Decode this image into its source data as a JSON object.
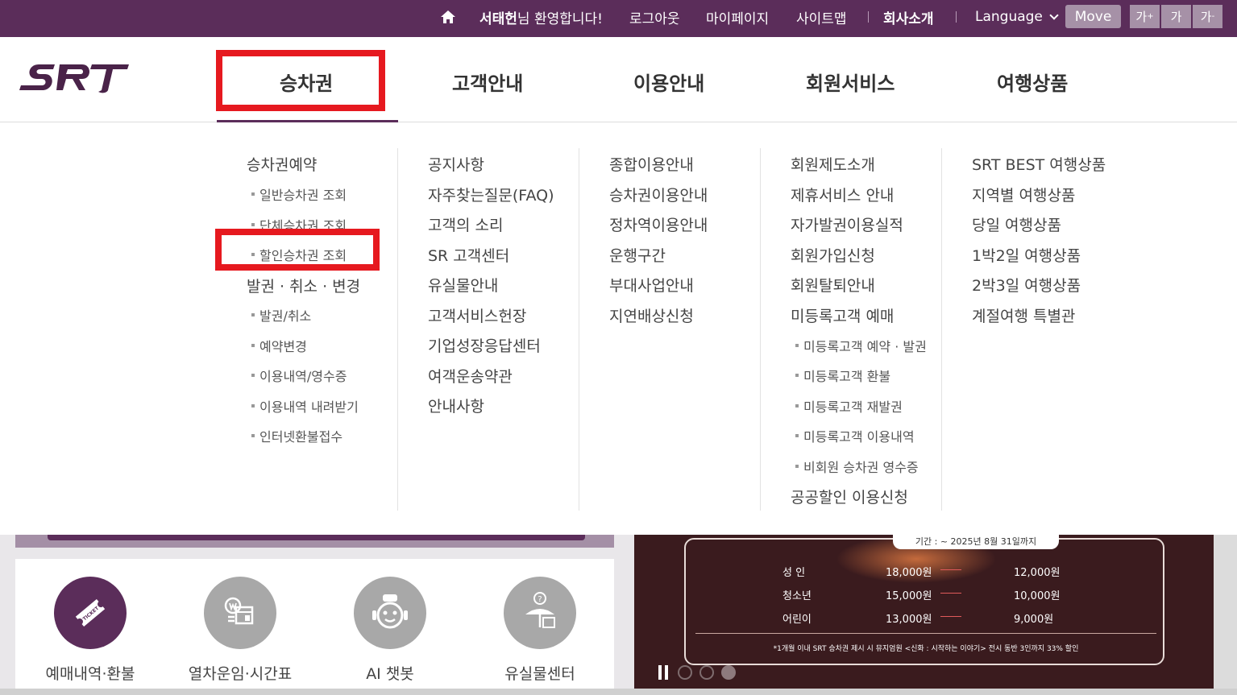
{
  "topbar": {
    "user_name": "서태헌",
    "welcome_suffix": "님 환영합니다!",
    "logout": "로그아웃",
    "mypage": "마이페이지",
    "sitemap": "사이트맵",
    "company": "회사소개",
    "language": "Language",
    "move": "Move",
    "font_large": "가",
    "font_large_sup": "+",
    "font_normal": "가",
    "font_small": "가",
    "font_small_sup": "-"
  },
  "gnb": {
    "items": [
      "승차권",
      "고객안내",
      "이용안내",
      "회원서비스",
      "여행상품"
    ]
  },
  "mega": {
    "col1": {
      "g1": "승차권예약",
      "g1_sub": [
        "일반승차권 조회",
        "단체승차권 조회",
        "할인승차권 조회"
      ],
      "g2": "발권 · 취소 · 변경",
      "g2_sub": [
        "발권/취소",
        "예약변경",
        "이용내역/영수증",
        "이용내역 내려받기",
        "인터넷환불접수"
      ]
    },
    "col2": [
      "공지사항",
      "자주찾는질문(FAQ)",
      "고객의 소리",
      "SR 고객센터",
      "유실물안내",
      "고객서비스헌장",
      "기업성장응답센터",
      "여객운송약관",
      "안내사항"
    ],
    "col3": [
      "종합이용안내",
      "승차권이용안내",
      "정차역이용안내",
      "운행구간",
      "부대사업안내",
      "지연배상신청"
    ],
    "col4": {
      "items": [
        "회원제도소개",
        "제휴서비스 안내",
        "자가발권이용실적",
        "회원가입신청",
        "회원탈퇴안내",
        "미등록고객 예매"
      ],
      "sub": [
        "미등록고객 예약 · 발권",
        "미등록고객 환불",
        "미등록고객 재발권",
        "미등록고객 이용내역",
        "비회원 승차권 영수증"
      ],
      "last": "공공할인 이용신청"
    },
    "col5": [
      "SRT BEST 여행상품",
      "지역별 여행상품",
      "당일 여행상품",
      "1박2일 여행상품",
      "2박3일 여행상품",
      "계절여행 특별관"
    ]
  },
  "quick": {
    "items": [
      "예매내역·환불",
      "열차운임·시간표",
      "AI 챗봇",
      "유실물센터"
    ],
    "ticket_icon_text": "TICKET"
  },
  "banner": {
    "period": "기간 : ~ 2025년 8월 31일까지",
    "rows": [
      {
        "label": "성   인",
        "price": "18,000원",
        "sale": "12,000원"
      },
      {
        "label": "청소년",
        "price": "15,000원",
        "sale": "10,000원"
      },
      {
        "label": "어린이",
        "price": "13,000원",
        "sale": "9,000원"
      }
    ],
    "note": "*1개월 이내 SRT 승차권 제시 시 뮤지엄원 <신화 : 시작하는 이야기> 전시 동반 3인까지 33% 할인"
  },
  "colors": {
    "brand": "#5b2d5a",
    "highlight": "#e6191f"
  }
}
